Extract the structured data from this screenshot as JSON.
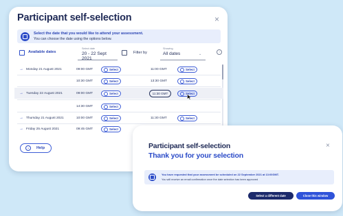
{
  "main": {
    "title": "Participant self-selection",
    "close": "×",
    "notice_bold": "Select the date that you would like to attend your assessment.",
    "notice_text": "You can choose the date using the options below.",
    "available_dates": "Available dates",
    "date_field_label": "Select date",
    "date_field_value": "20 - 22 Sept 2021",
    "filter_by": "Filter by",
    "showing_label": "Showing",
    "showing_value": "All dates",
    "select_label": "Select",
    "rows": [
      {
        "date": "Monday 21 August 2021",
        "t1": "09:00 GMT",
        "t2": "11:00 GMT"
      },
      {
        "date": "",
        "t1": "10:30 GMT",
        "t2": "13:30 GMT"
      },
      {
        "date": "Tuesday 22 August 2021",
        "t1": "09:00 GMT",
        "t2": "11:30 GMT"
      },
      {
        "date": "",
        "t1": "14:30 GMT",
        "t2": ""
      },
      {
        "date": "Thursday 21 August 2021",
        "t1": "10:00 GMT",
        "t2": "11:30 GMT"
      },
      {
        "date": "Friday 25 August 2021",
        "t1": "09:45 GMT",
        "t2": ""
      }
    ],
    "help": "Help"
  },
  "thanks": {
    "title1": "Participant self-selection",
    "title2": "Thank you for your selection",
    "close": "×",
    "msg_bold": "You have requested that your assessment be scheduled on 22 September 2021 at 13:00GMT.",
    "msg_text": "You will receive an email confirmation once the date selection has been approved",
    "btn_different": "Select a different date",
    "btn_close": "Close this window"
  },
  "colors": {
    "background": "#cfe8f8",
    "accent": "#2c4cc8",
    "navy": "#1f2a56"
  }
}
